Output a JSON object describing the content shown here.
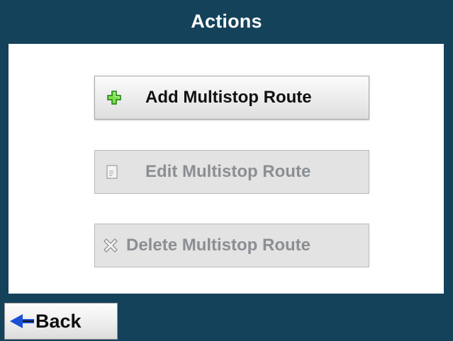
{
  "header": {
    "title": "Actions"
  },
  "actions": {
    "add": {
      "label": "Add Multistop Route",
      "icon": "plus-icon",
      "enabled": true
    },
    "edit": {
      "label": "Edit Multistop Route",
      "icon": "document-icon",
      "enabled": false
    },
    "delete": {
      "label": "Delete Multistop Route",
      "icon": "delete-x-icon",
      "enabled": false
    }
  },
  "footer": {
    "back_label": "Back",
    "back_icon": "left-arrow-icon"
  },
  "colors": {
    "frame": "#14425a",
    "panel": "#ffffff",
    "enabled_text": "#111111",
    "disabled_text": "#8b8f93",
    "plus_icon": "#3ec61e",
    "back_arrow": "#1a4fd6"
  }
}
